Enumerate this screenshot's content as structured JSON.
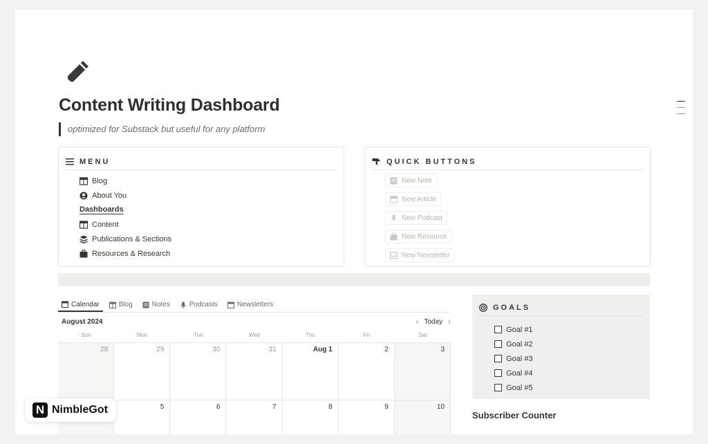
{
  "page": {
    "title": "Content Writing Dashboard",
    "subtitle": "optimized for Substack but useful for any platform",
    "icon": "pencil-icon"
  },
  "menu": {
    "heading": "MENU",
    "items": [
      {
        "label": "Blog",
        "icon": "calendar-board-icon"
      },
      {
        "label": "About You",
        "icon": "user-circle-icon"
      }
    ],
    "subheading": "Dashboards",
    "dashboard_items": [
      {
        "label": "Content",
        "icon": "calendar-board-icon"
      },
      {
        "label": "Publications & Sections",
        "icon": "layers-icon"
      },
      {
        "label": "Resources & Research",
        "icon": "briefcase-icon"
      }
    ]
  },
  "quick_buttons": {
    "heading": "QUICK BUTTONS",
    "buttons": [
      {
        "label": "New Note",
        "icon": "note-icon"
      },
      {
        "label": "New Article",
        "icon": "calendar-board-icon"
      },
      {
        "label": "New Podcast",
        "icon": "microphone-icon"
      },
      {
        "label": "New Resource",
        "icon": "briefcase-icon"
      },
      {
        "label": "New Newsletter",
        "icon": "inbox-icon"
      }
    ]
  },
  "tabs": [
    {
      "label": "Calendar",
      "icon": "calendar-icon",
      "active": true
    },
    {
      "label": "Blog",
      "icon": "calendar-board-icon",
      "active": false
    },
    {
      "label": "Notes",
      "icon": "note-icon",
      "active": false
    },
    {
      "label": "Podcasts",
      "icon": "microphone-icon",
      "active": false
    },
    {
      "label": "Newsletters",
      "icon": "inbox-icon",
      "active": false
    }
  ],
  "calendar": {
    "month": "August 2024",
    "today_label": "Today",
    "weekdays": [
      "Sun",
      "Mon",
      "Tue",
      "Wed",
      "Thu",
      "Fri",
      "Sat"
    ],
    "days": [
      "28",
      "29",
      "30",
      "31",
      "Aug 1",
      "2",
      "3",
      "",
      "5",
      "6",
      "7",
      "8",
      "9",
      "10"
    ]
  },
  "goals": {
    "heading": "GOALS",
    "items": [
      "Goal #1",
      "Goal #2",
      "Goal #3",
      "Goal #4",
      "Goal #5"
    ]
  },
  "subscriber_counter": "Subscriber Counter",
  "brand": {
    "logo_letter": "N",
    "name": "NimbleGot"
  }
}
